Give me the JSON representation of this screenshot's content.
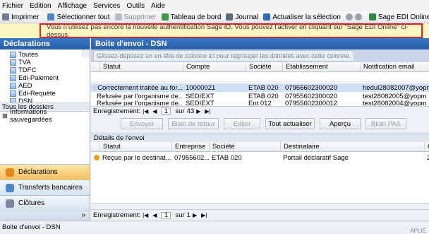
{
  "menu": [
    "Fichier",
    "Edition",
    "Affichage",
    "Services",
    "Outils",
    "Aide"
  ],
  "toolbar": {
    "print": "Imprimer",
    "select_all": "Sélectionner tout",
    "delete": "Supprimer",
    "dashboard": "Tableau de bord",
    "journal": "Journal",
    "refresh_selection": "Actualiser la sélection",
    "edi_online": "Sage EDI Online"
  },
  "banner": "Vous n'utilisez pas encore la nouvelle authentification Sage ID. Vous pouvez l'activer en cliquant sur \"Sage EDI Online\" ci-dessus.",
  "left": {
    "title": "Déclarations",
    "tree": [
      "Toutes",
      "TVA",
      "TDFC",
      "Edi-Paiement",
      "AED",
      "Edi-Requête",
      "DSN"
    ],
    "all_folders": "Tous les dossiers",
    "saved_info": "Informations sauvegardées",
    "nav": [
      "Déclarations",
      "Transferts bancaires",
      "Clôtures"
    ],
    "more": "»"
  },
  "main": {
    "title": "Boite d'envoi - DSN",
    "group_hint": "Glissez-déposez un en-tête de colonne ici pour regrouper les données avec cette colonne.",
    "columns": [
      "Statut",
      "Compte",
      "Société",
      "Etablissement",
      "Notification email"
    ],
    "rows": [
      {
        "statut": "Correctement traitée au for...",
        "compte": "10000021",
        "societe": "ETAB 020",
        "etab": "07955602300020",
        "email": "hedul28082007@yopm",
        "color": "#f0a020"
      },
      {
        "statut": "Refusée par l'organisme de...",
        "compte": "SEDIEXT",
        "societe": "ETAB 020",
        "etab": "07955602300020",
        "email": "test28082005@yopm",
        "color": "#d9252a"
      },
      {
        "statut": "Refusée par l'organisme de...",
        "compte": "SEDIEXT",
        "societe": "Ent 012",
        "etab": "07955602300012",
        "email": "test28082004@yopm",
        "color": "#d9252a"
      }
    ],
    "nav_label": "Enregistrement:",
    "nav_current": "1",
    "nav_of": "sur",
    "nav_total": "43",
    "buttons": [
      "Envoyer",
      "Bilan de retour",
      "Editer",
      "Tout actualiser",
      "Aperçu",
      "Bilan PAS"
    ],
    "enabled_buttons": [
      3,
      4
    ]
  },
  "details": {
    "title": "Détails de l'envoi",
    "columns": [
      "Statut",
      "Entreprise",
      "Société",
      "Destinataire",
      "C"
    ],
    "rows": [
      {
        "statut": "Reçue par le destinat...",
        "entreprise": "07955602...",
        "societe": "ETAB 020",
        "dest": "Portail déclaratif Sage",
        "c": "2",
        "color": "#f0a020"
      }
    ],
    "nav_current": "1",
    "nav_total": "1"
  },
  "status": "Boite d'envoi - DSN",
  "corner": "APLIE"
}
